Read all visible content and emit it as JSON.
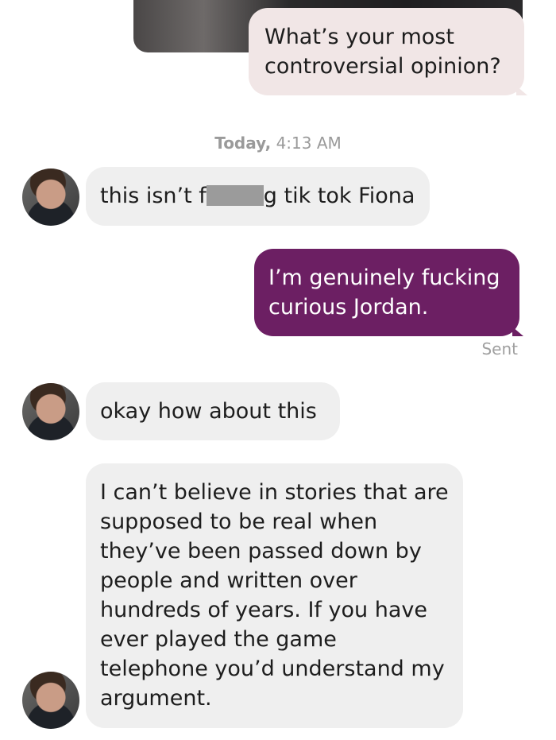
{
  "messages": {
    "m1": {
      "text": "What’s your most controversial opinion?"
    },
    "timestamp": {
      "day": "Today,",
      "time": "4:13 AM"
    },
    "m2": {
      "before": "this isn’t f",
      "after": "g tik tok Fiona"
    },
    "m3": {
      "text": "I’m genuinely fucking curious Jordan.",
      "status": "Sent"
    },
    "m4": {
      "text": "okay how about this"
    },
    "m5": {
      "text": "I can’t believe in stories that are supposed to be real when they’ve been passed down by people and written over hundreds of years. If you have ever played the game telephone you’d understand my argument."
    }
  },
  "colors": {
    "outgoing_light": "#f1e6e6",
    "outgoing_purple": "#6c1f63",
    "incoming": "#efefef",
    "meta_text": "#9a9a9a"
  },
  "icons": {
    "avatar": "user-avatar-photo",
    "redaction": "censor-block"
  }
}
